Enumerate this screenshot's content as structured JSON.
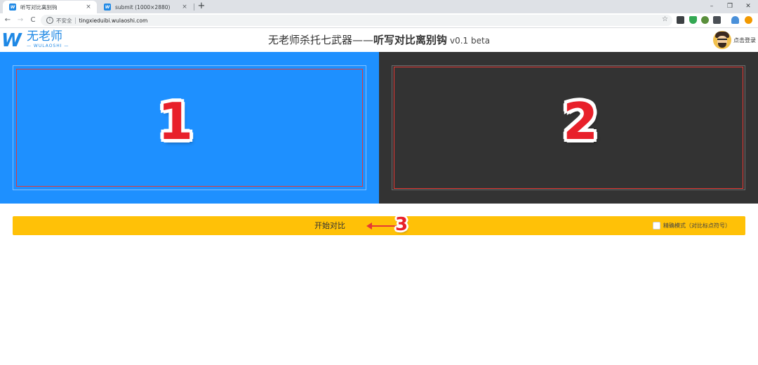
{
  "browser": {
    "tabs": [
      {
        "favicon": "W",
        "title": "听写对比离别钩",
        "close": "×"
      },
      {
        "favicon": "W",
        "title": "submit (1000×2880)",
        "close": "×"
      }
    ],
    "new_tab": "+",
    "window_controls": [
      "–",
      "❐",
      "✕"
    ],
    "nav": {
      "back": "←",
      "forward": "→",
      "reload": "C"
    },
    "address": {
      "info": "i",
      "not_secure": "不安全",
      "url": "tingxieduibi.wulaoshi.com"
    },
    "star": "☆"
  },
  "header": {
    "logo_mark": "W",
    "logo_text": "无老师",
    "logo_sub": "— WULAOSHI —",
    "title_part1": "无老师杀托七武器——",
    "title_part2": "听写对比离别钩",
    "version": "v0.1 beta",
    "login": "点击登录"
  },
  "panels": {
    "left_marker": "1",
    "right_marker": "2"
  },
  "action": {
    "start_label": "开始对比",
    "marker": "3",
    "precise_label": "精确模式（对比标点符号）"
  },
  "colors": {
    "left_panel": "#1e90ff",
    "right_panel": "#333333",
    "action_bar": "#ffc107",
    "annotation_red": "#e53935",
    "brand_blue": "#1e88e5"
  }
}
